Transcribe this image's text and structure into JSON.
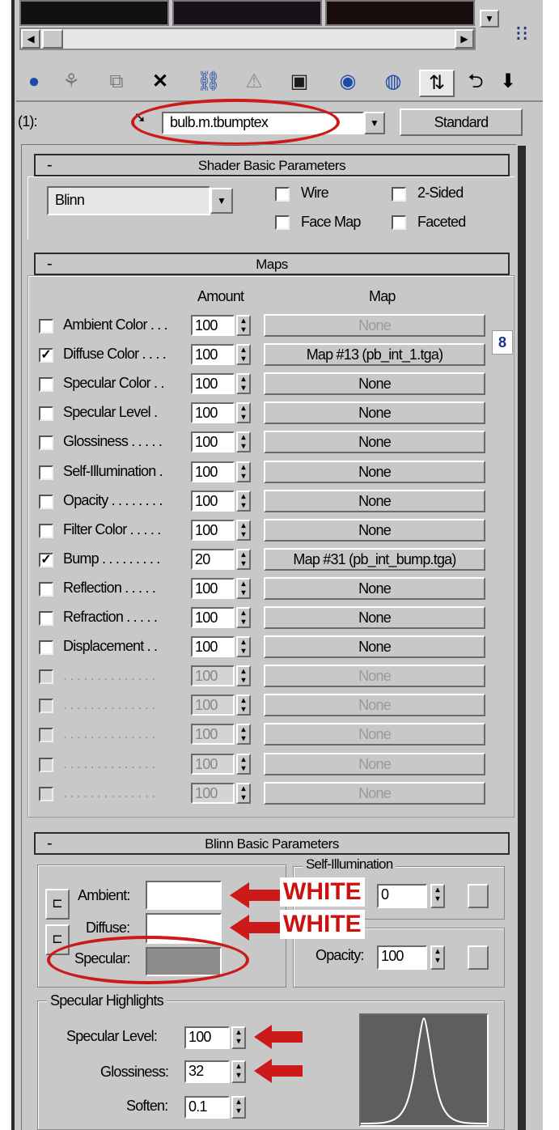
{
  "toolbar": {
    "level_label": "(1):",
    "material_name": "bulb.m.tbumptex",
    "type_button": "Standard"
  },
  "shader": {
    "title": "Shader Basic Parameters",
    "shader_type": "Blinn",
    "wire": "Wire",
    "two_sided": "2-Sided",
    "face_map": "Face Map",
    "faceted": "Faceted"
  },
  "maps": {
    "title": "Maps",
    "amount_header": "Amount",
    "map_header": "Map",
    "rows": [
      {
        "label": "Ambient Color . . .",
        "amount": "100",
        "map": "None",
        "checked": false,
        "map_disabled": true
      },
      {
        "label": "Diffuse Color . . . .",
        "amount": "100",
        "map": "Map #13 (pb_int_1.tga)",
        "checked": true,
        "map_disabled": false
      },
      {
        "label": "Specular Color . .",
        "amount": "100",
        "map": "None",
        "checked": false,
        "map_disabled": false
      },
      {
        "label": "Specular Level .",
        "amount": "100",
        "map": "None",
        "checked": false,
        "map_disabled": false
      },
      {
        "label": "Glossiness . . . . .",
        "amount": "100",
        "map": "None",
        "checked": false,
        "map_disabled": false
      },
      {
        "label": "Self-Illumination .",
        "amount": "100",
        "map": "None",
        "checked": false,
        "map_disabled": false
      },
      {
        "label": "Opacity . . . . . . . .",
        "amount": "100",
        "map": "None",
        "checked": false,
        "map_disabled": false
      },
      {
        "label": "Filter Color . . . . .",
        "amount": "100",
        "map": "None",
        "checked": false,
        "map_disabled": false
      },
      {
        "label": "Bump . . . . . . . . .",
        "amount": "20",
        "map": "Map #31 (pb_int_bump.tga)",
        "checked": true,
        "map_disabled": false
      },
      {
        "label": "Reflection . . . . .",
        "amount": "100",
        "map": "None",
        "checked": false,
        "map_disabled": false
      },
      {
        "label": "Refraction . . . . .",
        "amount": "100",
        "map": "None",
        "checked": false,
        "map_disabled": false
      },
      {
        "label": "Displacement . .",
        "amount": "100",
        "map": "None",
        "checked": false,
        "map_disabled": false
      },
      {
        "label": ". . . . . . . . . . . . . .",
        "amount": "100",
        "map": "None",
        "checked": false,
        "map_disabled": true
      },
      {
        "label": ". . . . . . . . . . . . . .",
        "amount": "100",
        "map": "None",
        "checked": false,
        "map_disabled": true
      },
      {
        "label": ". . . . . . . . . . . . . .",
        "amount": "100",
        "map": "None",
        "checked": false,
        "map_disabled": true
      },
      {
        "label": ". . . . . . . . . . . . . .",
        "amount": "100",
        "map": "None",
        "checked": false,
        "map_disabled": true
      },
      {
        "label": ". . . . . . . . . . . . . .",
        "amount": "100",
        "map": "None",
        "checked": false,
        "map_disabled": true
      }
    ]
  },
  "blinn": {
    "title": "Blinn Basic Parameters",
    "ambient_label": "Ambient:",
    "diffuse_label": "Diffuse:",
    "specular_label": "Specular:",
    "self_illum_title": "Self-Illumination",
    "self_illum_value": "0",
    "opacity_label": "Opacity:",
    "opacity_value": "100",
    "ambient_color": "#ffffff",
    "diffuse_color": "#ffffff",
    "specular_color": "#8c8c8c"
  },
  "highlights": {
    "title": "Specular Highlights",
    "specular_level_label": "Specular Level:",
    "specular_level_value": "100",
    "glossiness_label": "Glossiness:",
    "glossiness_value": "32",
    "soften_label": "Soften:",
    "soften_value": "0.1"
  },
  "annotations": {
    "white_1": "WHITE",
    "white_2": "WHITE",
    "accent_color": "#cc1a1a"
  }
}
